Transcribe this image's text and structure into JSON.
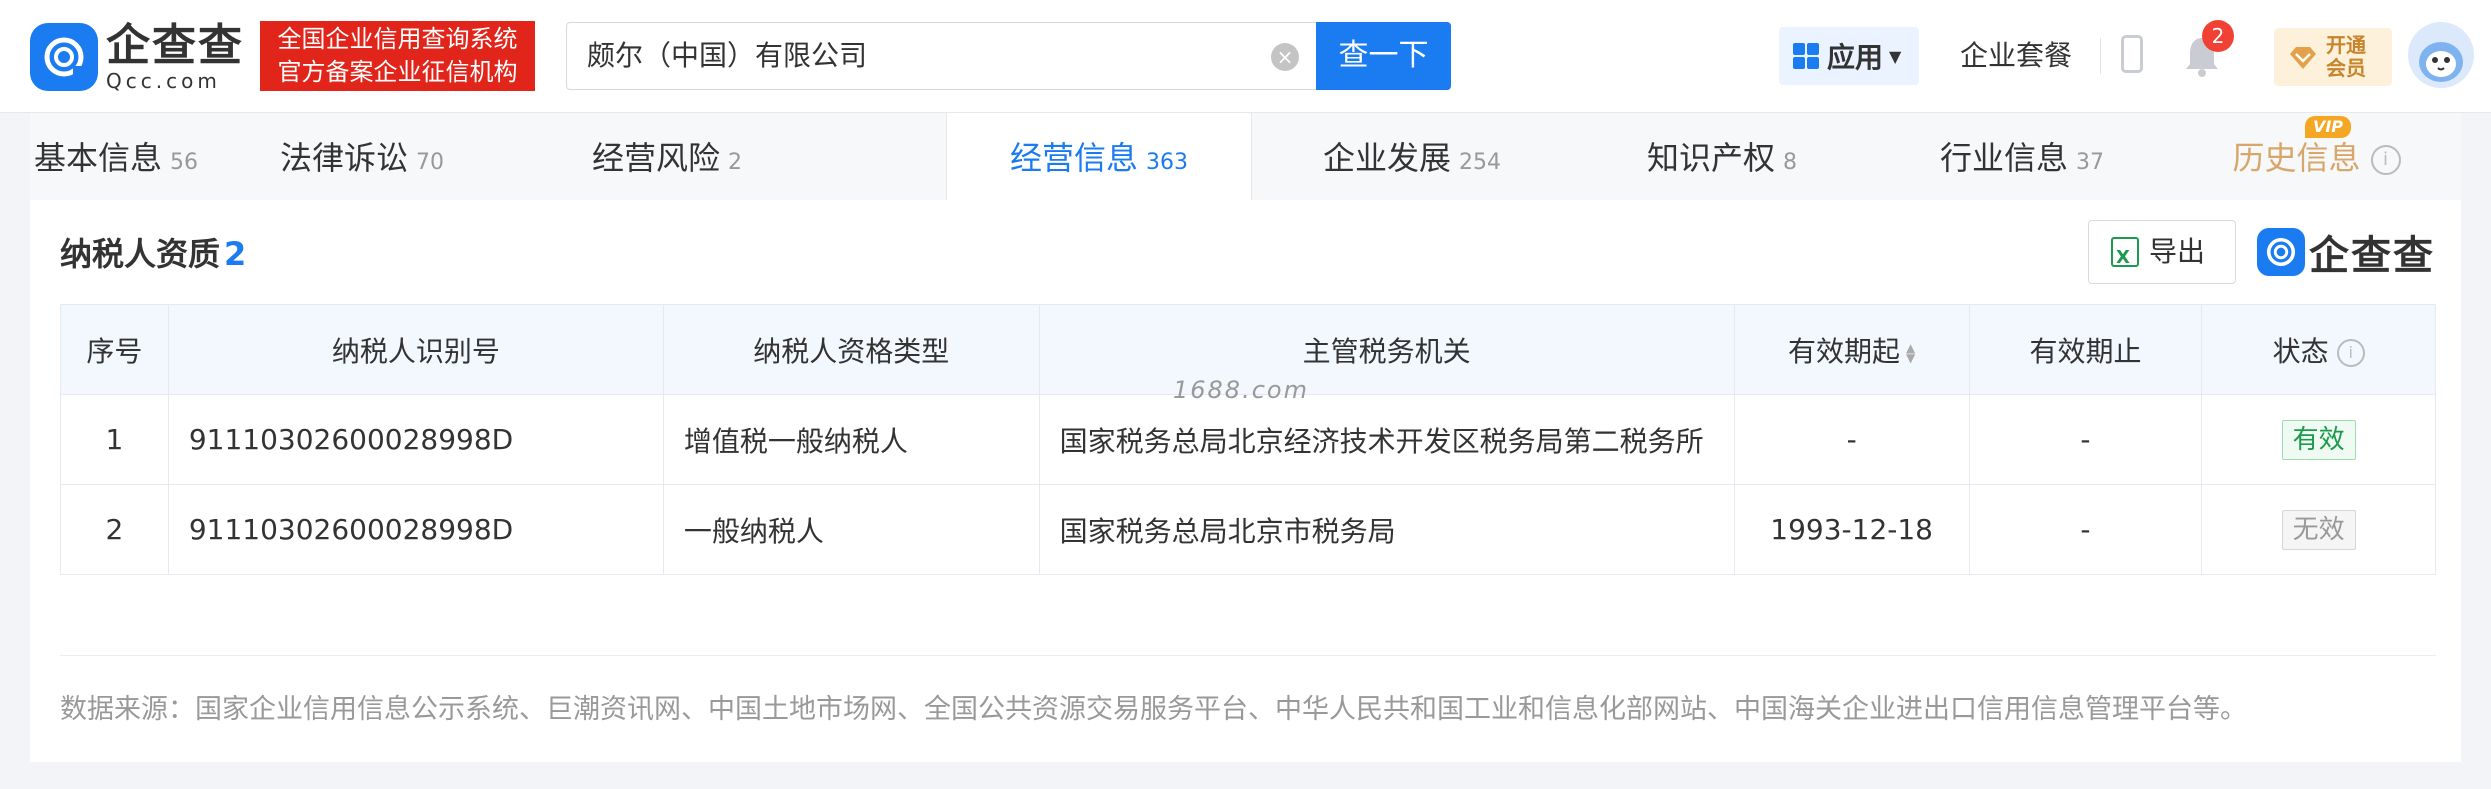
{
  "header": {
    "logo_cn": "企查查",
    "logo_en": "Qcc.com",
    "badge_line1": "全国企业信用查询系统",
    "badge_line2": "官方备案企业征信机构",
    "search_value": "颇尔（中国）有限公司",
    "search_button": "查一下",
    "apps_label": "应用",
    "enterprise_suite": "企业套餐",
    "notification_count": "2",
    "vip_line1": "开通",
    "vip_line2": "会员"
  },
  "tabs": [
    {
      "label": "基本信息",
      "count": "56"
    },
    {
      "label": "法律诉讼",
      "count": "70"
    },
    {
      "label": "经营风险",
      "count": "2"
    },
    {
      "label": "经营信息",
      "count": "363"
    },
    {
      "label": "企业发展",
      "count": "254"
    },
    {
      "label": "知识产权",
      "count": "8"
    },
    {
      "label": "行业信息",
      "count": "37"
    },
    {
      "label": "历史信息",
      "count": ""
    }
  ],
  "active_tab": "经营信息",
  "vip_tag": "VIP",
  "section": {
    "title": "纳税人资质",
    "count": "2",
    "export_label": "导出",
    "brand": "企查查"
  },
  "table": {
    "headers": [
      "序号",
      "纳税人识别号",
      "纳税人资格类型",
      "主管税务机关",
      "有效期起",
      "有效期止",
      "状态"
    ],
    "rows": [
      {
        "no": "1",
        "taxpayer_id": "91110302600028998D",
        "type": "增值税一般纳税人",
        "authority": "国家税务总局北京经济技术开发区税务局第二税务所",
        "start": "-",
        "end": "-",
        "status": "有效"
      },
      {
        "no": "2",
        "taxpayer_id": "91110302600028998D",
        "type": "一般纳税人",
        "authority": "国家税务总局北京市税务局",
        "start": "1993-12-18",
        "end": "-",
        "status": "无效"
      }
    ]
  },
  "watermark": "1688.com",
  "data_source": "数据来源：国家企业信用信息公示系统、巨潮资讯网、中国土地市场网、全国公共资源交易服务平台、中华人民共和国工业和信息化部网站、中国海关企业进出口信用信息管理平台等。",
  "colors": {
    "brand_blue": "#1a7cf0",
    "badge_red": "#e1251b",
    "valid_green": "#1a9a4a",
    "vip_gold": "#c8842a"
  }
}
